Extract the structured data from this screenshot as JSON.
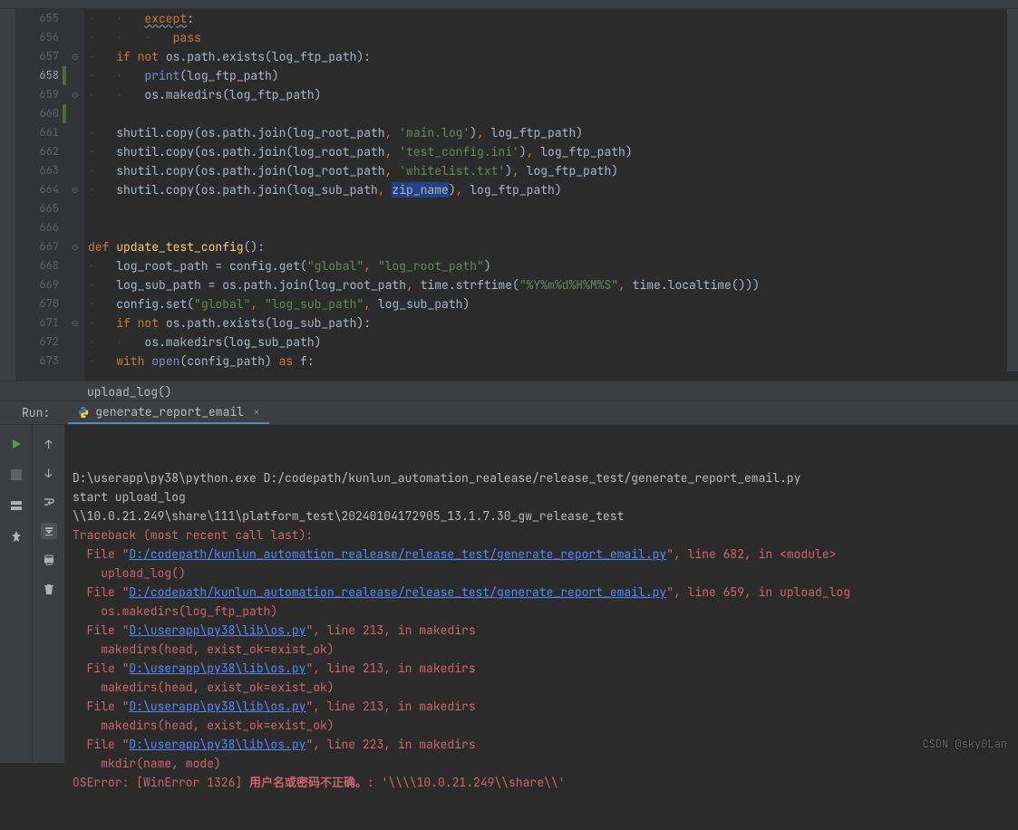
{
  "lines": [
    {
      "n": "655",
      "fold": "",
      "code": "        <span class='kw'><span class='wave'>except</span></span>:"
    },
    {
      "n": "656",
      "fold": "",
      "code": "            <span class='kw'>pass</span>"
    },
    {
      "n": "657",
      "fold": "⊖",
      "code": "    <span class='kw'>if not</span> os.path.exists(log_ftp_path):"
    },
    {
      "n": "658",
      "fold": "",
      "code": "        <span class='builtin'>print</span>(log_ftp_path)",
      "change": true
    },
    {
      "n": "659",
      "fold": "⊖",
      "code": "        os.makedirs(log_ftp_path)"
    },
    {
      "n": "660",
      "fold": "",
      "code": "",
      "change": true
    },
    {
      "n": "661",
      "fold": "",
      "code": "    shutil.copy(os.path.join(log_root_path<span class='kw'>, </span><span class='str'>'main.log'</span>)<span class='kw'>,</span> log_ftp_path)"
    },
    {
      "n": "662",
      "fold": "",
      "code": "    shutil.copy(os.path.join(log_root_path<span class='kw'>, </span><span class='str'>'test_config.ini'</span>)<span class='kw'>,</span> log_ftp_path)"
    },
    {
      "n": "663",
      "fold": "",
      "code": "    shutil.copy(os.path.join(log_root_path<span class='kw'>, </span><span class='str'>'whitelist.txt'</span>)<span class='kw'>,</span> log_ftp_path)"
    },
    {
      "n": "664",
      "fold": "⊖",
      "code": "    shutil.copy(os.path.join(log_sub_path<span class='kw'>, </span><span class='param-highlight'>zip_name</span>)<span class='kw'>,</span> log_ftp_path)"
    },
    {
      "n": "665",
      "fold": "",
      "code": ""
    },
    {
      "n": "666",
      "fold": "",
      "code": ""
    },
    {
      "n": "667",
      "fold": "⊖",
      "code": "<span class='kw'>def </span><span class='fn'>update_test_config</span>():"
    },
    {
      "n": "668",
      "fold": "",
      "code": "    log_root_path = config.get(<span class='str'>\"global\"</span><span class='kw'>, </span><span class='str'>\"log_root_path\"</span>)"
    },
    {
      "n": "669",
      "fold": "",
      "code": "    log_sub_path = os.path.join(log_root_path<span class='kw'>,</span> time.strftime(<span class='str'>\"%Y%m%d%H%M%S\"</span><span class='kw'>,</span> time.localtime()))"
    },
    {
      "n": "670",
      "fold": "",
      "code": "    config.set(<span class='str'>\"global\"</span><span class='kw'>, </span><span class='str'>\"log_sub_path\"</span><span class='kw'>,</span> log_sub_path)"
    },
    {
      "n": "671",
      "fold": "⊖",
      "code": "    <span class='kw'>if not</span> os.path.exists(log_sub_path):"
    },
    {
      "n": "672",
      "fold": "",
      "code": "        os.makedirs(log_sub_path)"
    },
    {
      "n": "673",
      "fold": "",
      "code": "    <span class='kw'>with </span><span class='builtin'>open</span>(config_path) <span class='kw'>as</span> f:"
    }
  ],
  "breadcrumb": "upload_log()",
  "run": {
    "label": "Run:",
    "tab": "generate_report_email",
    "console": [
      {
        "t": "D:\\userapp\\py38\\python.exe D:/codepath/kunlun_automation_realease/release_test/generate_report_email.py"
      },
      {
        "t": "start upload_log"
      },
      {
        "t": "\\\\10.0.21.249\\share\\111\\platform_test\\20240104172905_13.1.7.30_gw_release_test"
      },
      {
        "c": "trace",
        "t": "Traceback (most recent call last):"
      },
      {
        "c": "trace",
        "h": "  File \"<a>D:/codepath/kunlun_automation_realease/release_test/generate_report_email.py</a>\", line 682, in &lt;module&gt;"
      },
      {
        "c": "trace",
        "t": "    upload_log()"
      },
      {
        "c": "trace",
        "h": "  File \"<a>D:/codepath/kunlun_automation_realease/release_test/generate_report_email.py</a>\", line 659, in upload_log"
      },
      {
        "c": "trace",
        "t": "    os.makedirs(log_ftp_path)"
      },
      {
        "c": "trace",
        "h": "  File \"<a>D:\\userapp\\py38\\lib\\os.py</a>\", line 213, in makedirs"
      },
      {
        "c": "trace",
        "t": "    makedirs(head, exist_ok=exist_ok)"
      },
      {
        "c": "trace",
        "h": "  File \"<a>D:\\userapp\\py38\\lib\\os.py</a>\", line 213, in makedirs"
      },
      {
        "c": "trace",
        "t": "    makedirs(head, exist_ok=exist_ok)"
      },
      {
        "c": "trace",
        "h": "  File \"<a>D:\\userapp\\py38\\lib\\os.py</a>\", line 213, in makedirs"
      },
      {
        "c": "trace",
        "t": "    makedirs(head, exist_ok=exist_ok)"
      },
      {
        "c": "trace",
        "h": "  File \"<a>D:\\userapp\\py38\\lib\\os.py</a>\", line 223, in makedirs"
      },
      {
        "c": "trace",
        "t": "    mkdir(name, mode)"
      },
      {
        "c": "trace",
        "h": "OSError: [WinError 1326] <span class='err-bold'>用户名或密码不正确。</span>: '\\\\\\\\10.0.21.249\\\\share\\\\'"
      }
    ]
  },
  "watermark": "CSDN @sky0Lan"
}
